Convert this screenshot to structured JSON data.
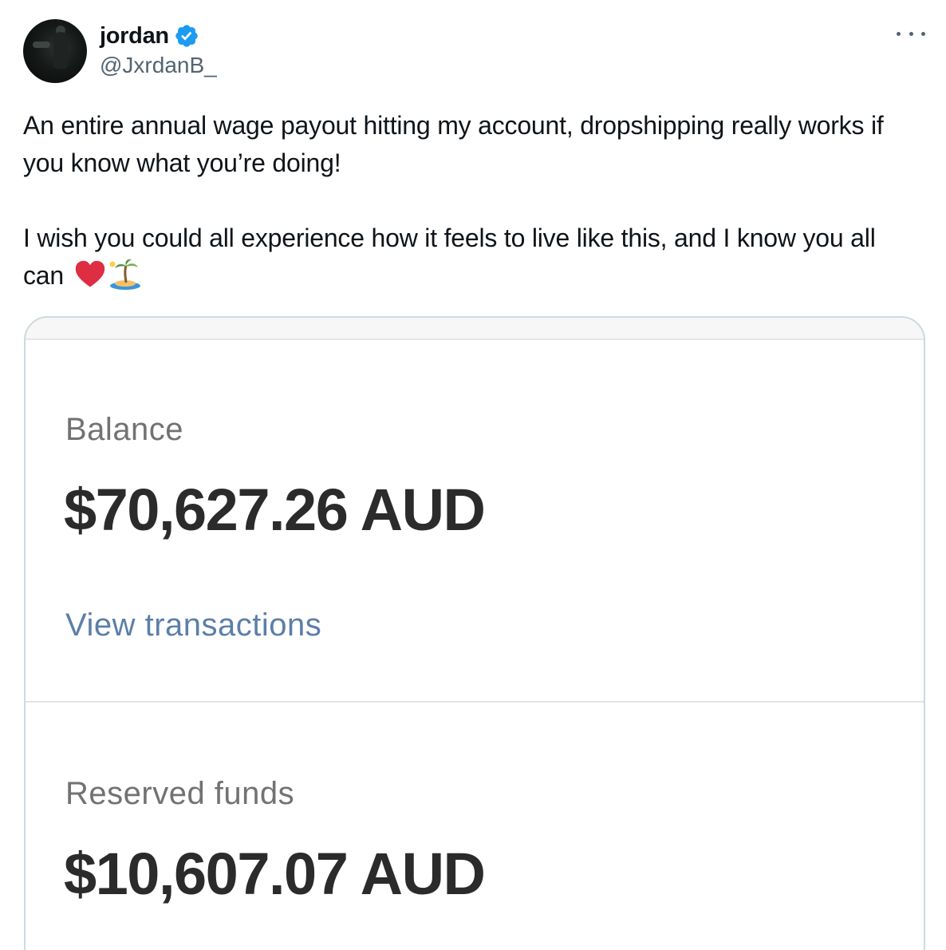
{
  "author": {
    "display_name": "jordan",
    "handle": "@JxrdanB_",
    "verified": true
  },
  "tweet": {
    "paragraph_1": "An entire annual wage payout hitting my account, dropshipping really works if you know what you’re doing!",
    "paragraph_2": "I wish you could all experience how it feels to live like this, and I know you all can",
    "emojis": [
      "red-heart",
      "desert-island"
    ]
  },
  "media": {
    "balance_label": "Balance",
    "balance_amount": "$70,627.26 AUD",
    "view_transactions": "View transactions",
    "reserved_label": "Reserved funds",
    "reserved_amount": "$10,607.07 AUD"
  },
  "colors": {
    "verified_badge": "#1d9bf0",
    "link": "#5b7fa8",
    "secondary_text": "#536471"
  }
}
